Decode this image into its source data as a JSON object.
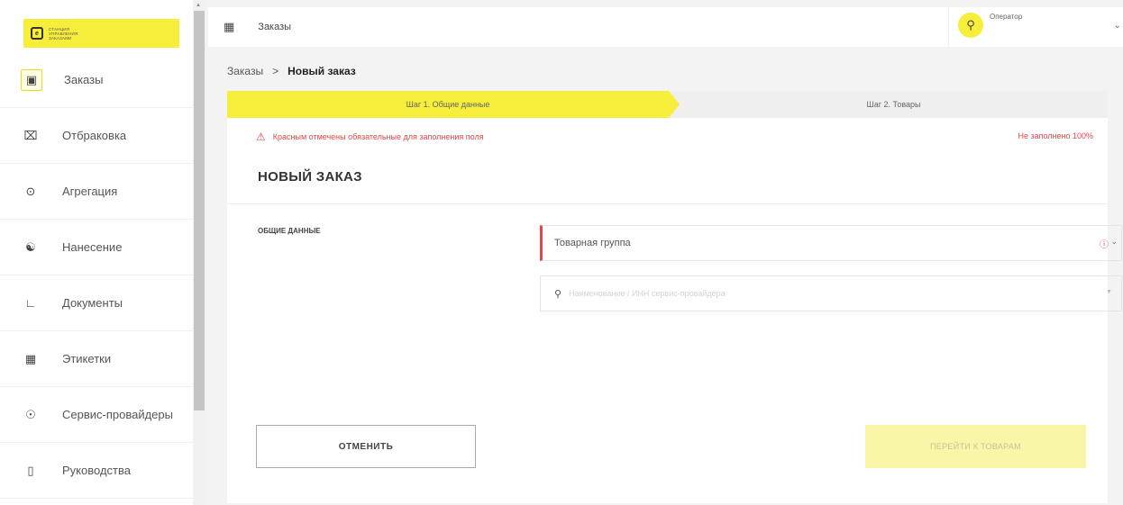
{
  "logo": {
    "icon": "logo-mark",
    "text": "Станция управления заказами"
  },
  "sidebar": {
    "items": [
      {
        "label": "Заказы",
        "icon": "order-box-icon",
        "active": true
      },
      {
        "label": "Отбраковка",
        "icon": "reject-icon"
      },
      {
        "label": "Агрегация",
        "icon": "aggregation-icon"
      },
      {
        "label": "Нанесение",
        "icon": "application-icon"
      },
      {
        "label": "Документы",
        "icon": "documents-icon"
      },
      {
        "label": "Этикетки",
        "icon": "labels-icon"
      },
      {
        "label": "Сервис-провайдеры",
        "icon": "service-provider-icon"
      },
      {
        "label": "Руководства",
        "icon": "manuals-icon"
      }
    ]
  },
  "topbar": {
    "title": "Заказы",
    "user": {
      "name": "Оператор"
    }
  },
  "breadcrumb": {
    "parent": "Заказы",
    "separator": ">",
    "current": "Новый заказ"
  },
  "steps": {
    "step1": "Шаг 1. Общие данные",
    "step2": "Шаг 2. Товары"
  },
  "warning": {
    "text": "Красным отмечены обязательные для заполнения поля",
    "status": "Не заполнено 100%"
  },
  "form": {
    "title": "НОВЫЙ ЗАКАЗ",
    "section": "ОБЩИЕ ДАННЫЕ",
    "product_group_label": "Товарная группа",
    "search_placeholder": "Наименование / ИНН сервис-провайдера"
  },
  "buttons": {
    "cancel": "ОТМЕНИТЬ",
    "next": "ПЕРЕЙТИ К ТОВАРАМ"
  },
  "colors": {
    "accent": "#f6ee3b",
    "error": "#e04848"
  }
}
